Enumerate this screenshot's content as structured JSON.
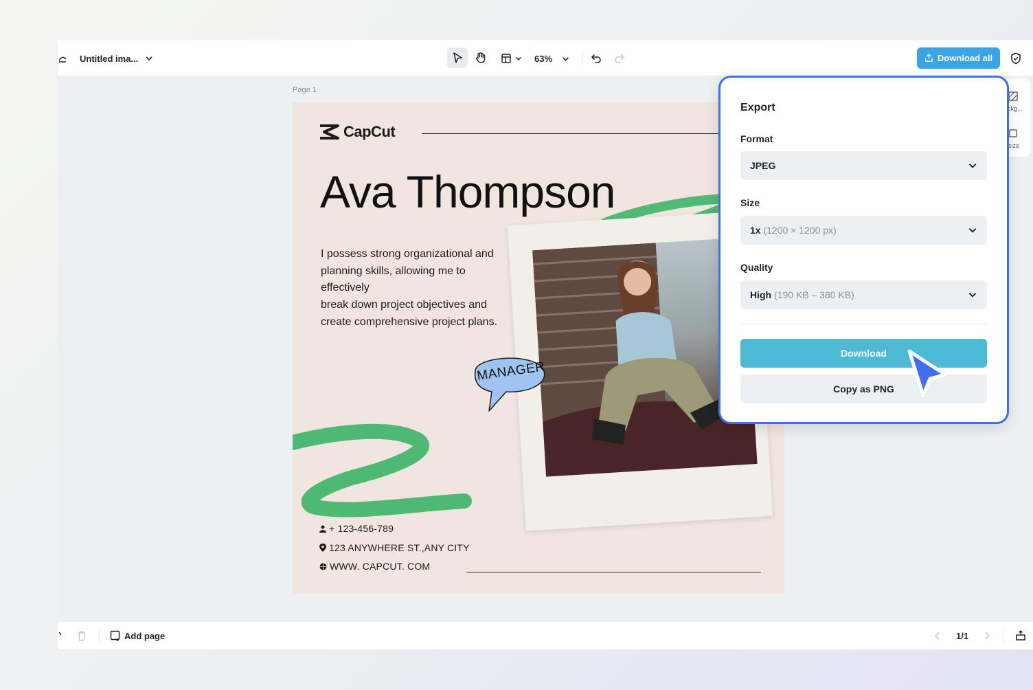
{
  "topbar": {
    "title": "Untitled ima...",
    "zoom": "63%",
    "download_all": "Download all"
  },
  "canvas": {
    "page_label": "Page 1",
    "brand": "CapCut",
    "name": "Ava Thompson",
    "bio": "I possess strong organizational and planning skills, allowing me to effectively\nbreak down project objectives and create comprehensive project plans.",
    "badge": "MANAGER",
    "contacts": [
      {
        "icon": "person-icon",
        "text": "+ 123-456-789"
      },
      {
        "icon": "location-pin-icon",
        "text": "123 ANYWHERE ST.,ANY CITY"
      },
      {
        "icon": "globe-icon",
        "text": "WWW. CAPCUT. COM"
      }
    ]
  },
  "side_panel": {
    "item1": "ckg...",
    "item2": "size"
  },
  "statusbar": {
    "add_page": "Add page",
    "pager": "1/1"
  },
  "export": {
    "title": "Export",
    "format_label": "Format",
    "format_value": "JPEG",
    "size_label": "Size",
    "size_value": "1x",
    "size_detail": "(1200 × 1200 px)",
    "quality_label": "Quality",
    "quality_value": "High",
    "quality_detail": "(190 KB – 380 KB)",
    "download": "Download",
    "copy_png": "Copy as PNG"
  },
  "colors": {
    "accent": "#3aa4e6",
    "download_button": "#4cbad5",
    "panel_border": "#3f6ef0",
    "canvas_bg": "#f1e5df",
    "brush_green": "#3fb56a",
    "bubble_blue": "#9fc4f2"
  }
}
